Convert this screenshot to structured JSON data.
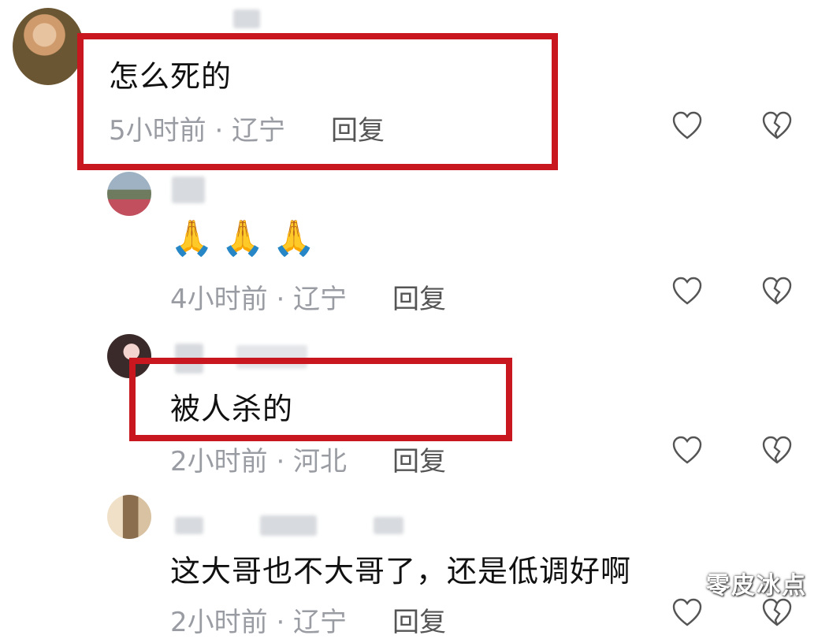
{
  "comments": [
    {
      "text": "怎么死的",
      "meta": "5小时前 · 辽宁",
      "reply_label": "回复"
    },
    {
      "text": "🙏🙏🙏",
      "meta": "4小时前 · 辽宁",
      "reply_label": "回复"
    },
    {
      "text": "被人杀的",
      "meta": "2小时前 · 河北",
      "reply_label": "回复"
    },
    {
      "text": "这大哥也不大哥了，还是低调好啊",
      "meta": "2小时前 · 辽宁",
      "reply_label": "回复"
    }
  ],
  "icons": {
    "like": "heart-outline-icon",
    "dislike": "broken-heart-icon"
  },
  "colors": {
    "highlight_box": "#c8171e",
    "meta_text": "#9a9ca3",
    "icon_stroke": "#555555"
  },
  "watermark": "零皮冰点"
}
